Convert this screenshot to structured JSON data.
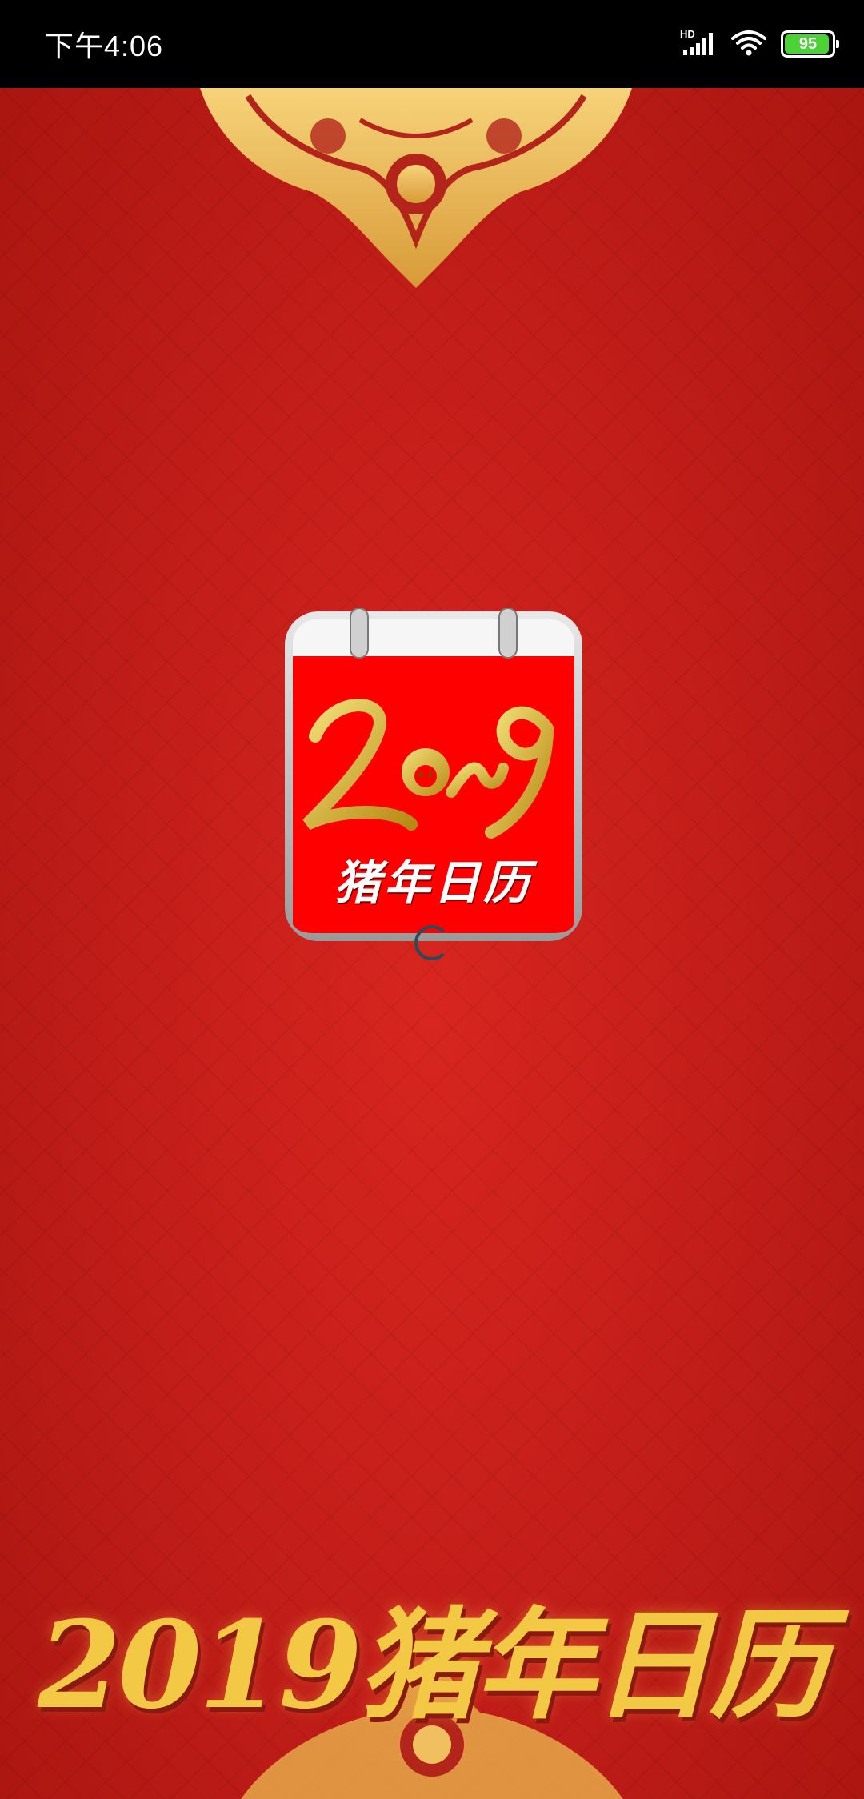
{
  "status_bar": {
    "time": "下午4:06",
    "network_label": "HD",
    "battery_level": "95",
    "battery_fraction": 0.95,
    "signal_icon": "signal-icon",
    "wifi_icon": "wifi-icon",
    "battery_icon": "battery-icon"
  },
  "splash": {
    "icon_year_logo": "2019",
    "icon_caption": "猪年日历",
    "loading_icon": "spinner-icon",
    "bottom_title": "2019猪年日历"
  },
  "colors": {
    "background_red": "#c41e1a",
    "gold": "#f3c845",
    "icon_red": "#ff0000",
    "battery_green": "#4cd137"
  }
}
